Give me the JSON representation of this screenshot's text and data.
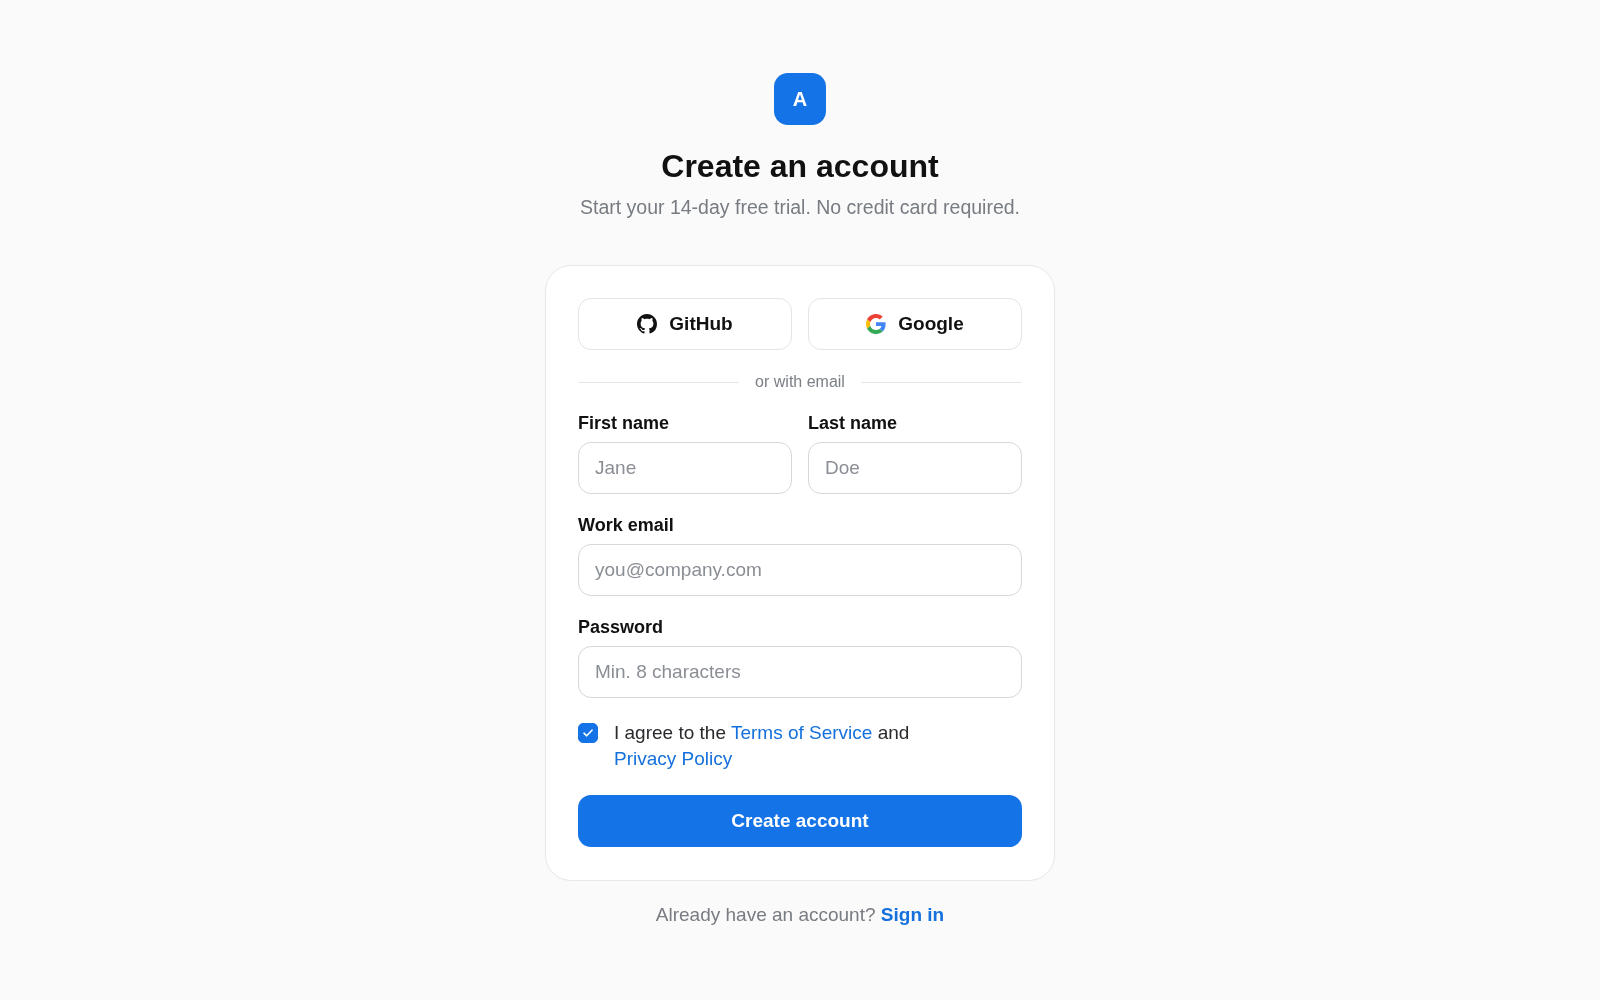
{
  "logo": {
    "letter": "A"
  },
  "header": {
    "title": "Create an account",
    "subtitle": "Start your 14-day free trial. No credit card required."
  },
  "social_buttons": [
    {
      "kind": "github",
      "label": "GitHub"
    },
    {
      "kind": "google",
      "label": "Google"
    }
  ],
  "divider": {
    "text": "or with email"
  },
  "field_rows": [
    {
      "fields": [
        {
          "label": "First name",
          "placeholder": "Jane"
        },
        {
          "label": "Last name",
          "placeholder": "Doe"
        }
      ]
    },
    {
      "fields": [
        {
          "label": "Work email",
          "placeholder": "you@company.com"
        }
      ]
    },
    {
      "fields": [
        {
          "label": "Password",
          "placeholder": "Min. 8 characters"
        }
      ]
    }
  ],
  "terms": {
    "checked": true,
    "parts": [
      {
        "kind": "text",
        "text": "I agree to the "
      },
      {
        "kind": "link",
        "text": "Terms of Service"
      },
      {
        "kind": "text",
        "text": " and "
      },
      {
        "kind": "link",
        "text": "Privacy Policy"
      }
    ]
  },
  "submit_button": {
    "label": "Create account"
  },
  "footer": {
    "text": "Already have an account?",
    "link": "Sign in"
  }
}
